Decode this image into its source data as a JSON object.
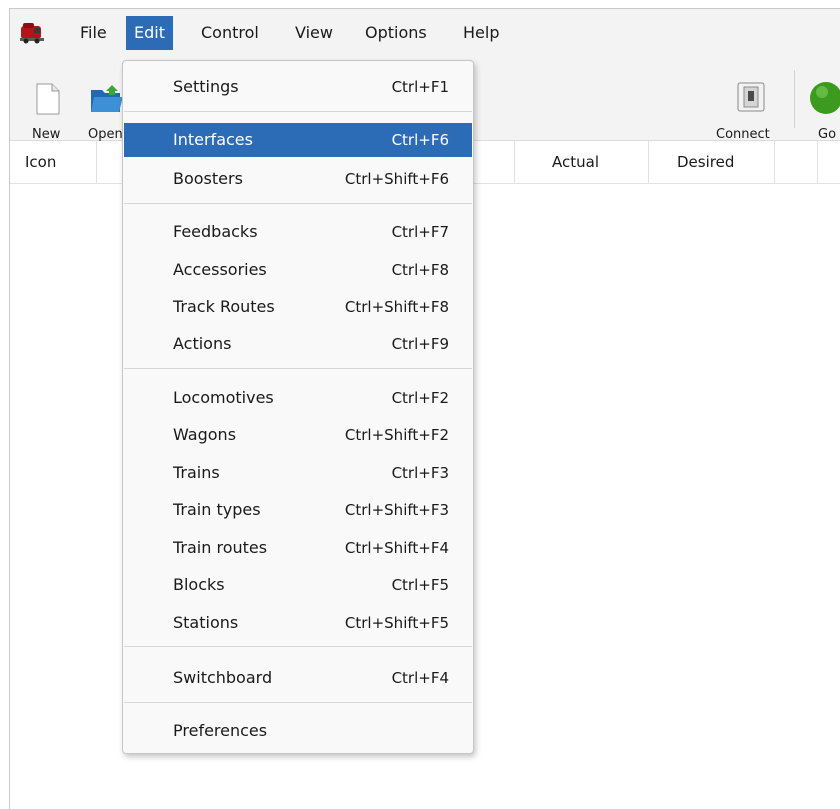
{
  "menubar": {
    "items": [
      {
        "label": "File"
      },
      {
        "label": "Edit"
      },
      {
        "label": "Control"
      },
      {
        "label": "View"
      },
      {
        "label": "Options"
      },
      {
        "label": "Help"
      }
    ]
  },
  "toolbar": {
    "new_label": "New",
    "open_label": "Open",
    "connect_label": "Connect",
    "go_label": "Go"
  },
  "table": {
    "columns": [
      {
        "label": "Icon"
      },
      {
        "label": "Actual"
      },
      {
        "label": "Desired"
      }
    ]
  },
  "edit_menu": {
    "items": [
      {
        "label": "Settings",
        "shortcut": "Ctrl+F1"
      },
      {
        "label": "Interfaces",
        "shortcut": "Ctrl+F6"
      },
      {
        "label": "Boosters",
        "shortcut": "Ctrl+Shift+F6"
      },
      {
        "label": "Feedbacks",
        "shortcut": "Ctrl+F7"
      },
      {
        "label": "Accessories",
        "shortcut": "Ctrl+F8"
      },
      {
        "label": "Track Routes",
        "shortcut": "Ctrl+Shift+F8"
      },
      {
        "label": "Actions",
        "shortcut": "Ctrl+F9"
      },
      {
        "label": "Locomotives",
        "shortcut": "Ctrl+F2"
      },
      {
        "label": "Wagons",
        "shortcut": "Ctrl+Shift+F2"
      },
      {
        "label": "Trains",
        "shortcut": "Ctrl+F3"
      },
      {
        "label": "Train types",
        "shortcut": "Ctrl+Shift+F3"
      },
      {
        "label": "Train routes",
        "shortcut": "Ctrl+Shift+F4"
      },
      {
        "label": "Blocks",
        "shortcut": "Ctrl+F5"
      },
      {
        "label": "Stations",
        "shortcut": "Ctrl+Shift+F5"
      },
      {
        "label": "Switchboard",
        "shortcut": "Ctrl+F4"
      },
      {
        "label": "Preferences",
        "shortcut": ""
      }
    ]
  },
  "colors": {
    "accent": "#2c6bb5",
    "menubar_bg": "#f3f3f3",
    "dropdown_bg": "#f9f9f9",
    "go_green": "#3c9a1e"
  }
}
